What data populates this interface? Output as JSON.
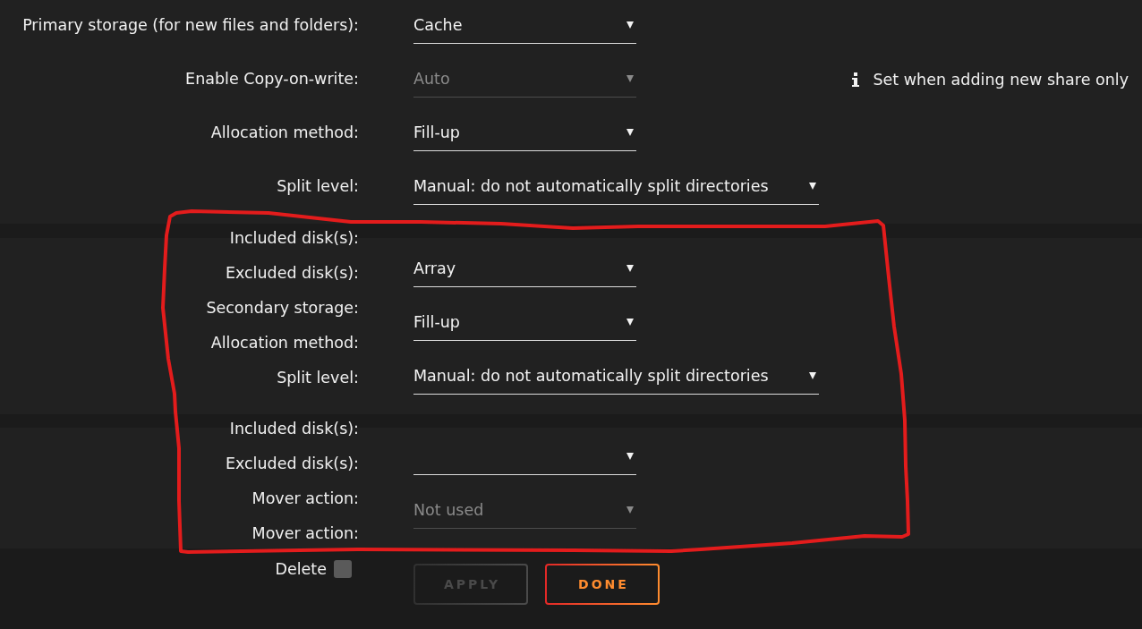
{
  "sections": [
    {
      "labels": [
        "Primary storage (for new files and folders):",
        "Enable Copy-on-write:",
        "Allocation method:",
        "Split level:"
      ],
      "controls": [
        {
          "value": "Cache",
          "disabled": false
        },
        {
          "value": "Auto",
          "disabled": true,
          "note": "Set when adding new share only"
        },
        {
          "value": "Fill-up",
          "disabled": false
        },
        {
          "value": "Manual: do not automatically split directories",
          "disabled": false
        }
      ]
    },
    {
      "labels": [
        "Included disk(s):",
        "Excluded disk(s):",
        "Secondary storage:",
        "Allocation method:",
        "Split level:"
      ],
      "controls": [
        {
          "value": "Array",
          "disabled": false
        },
        {
          "value": "Fill-up",
          "disabled": false
        },
        {
          "value": "Manual: do not automatically split directories",
          "disabled": false
        }
      ]
    },
    {
      "labels": [
        "Included disk(s):",
        "Excluded disk(s):",
        "Mover action:",
        "Mover action:"
      ],
      "controls": [
        {
          "disabled": false
        },
        {
          "value": "Not used",
          "disabled": true
        }
      ]
    }
  ],
  "footer": {
    "delete": {
      "label": "Delete",
      "checked": false
    },
    "buttons": [
      {
        "label": "APPLY",
        "disabled": true
      },
      {
        "label": "DONE",
        "disabled": false
      }
    ]
  },
  "annotations": [
    {
      "kind": "freehand-outline"
    }
  ]
}
